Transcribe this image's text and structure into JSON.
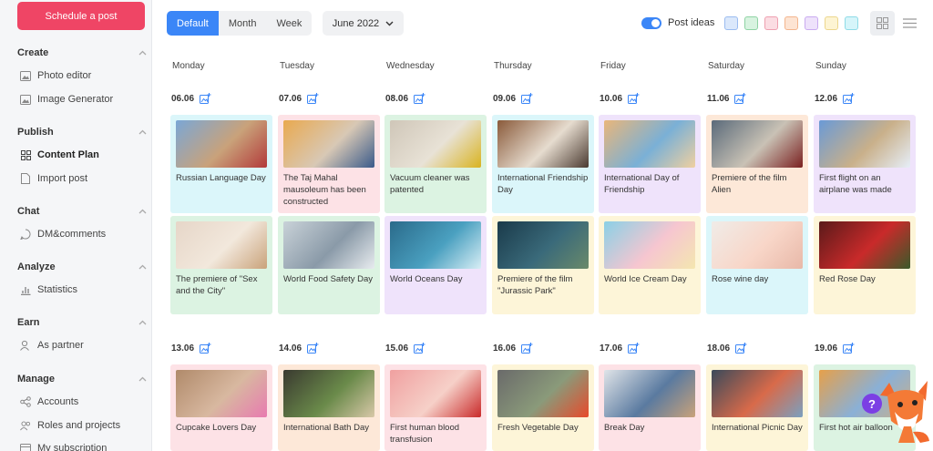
{
  "sidebar": {
    "schedule_button": "Schedule a post",
    "sections": [
      {
        "title": "Create",
        "items": [
          {
            "label": "Photo editor",
            "icon": "image-icon"
          },
          {
            "label": "Image Generator",
            "icon": "image-icon"
          }
        ]
      },
      {
        "title": "Publish",
        "items": [
          {
            "label": "Content Plan",
            "icon": "grid-icon",
            "active": true
          },
          {
            "label": "Import post",
            "icon": "document-icon"
          }
        ]
      },
      {
        "title": "Chat",
        "items": [
          {
            "label": "DM&comments",
            "icon": "chat-icon"
          }
        ]
      },
      {
        "title": "Analyze",
        "items": [
          {
            "label": "Statistics",
            "icon": "chart-icon"
          }
        ]
      },
      {
        "title": "Earn",
        "items": [
          {
            "label": "As partner",
            "icon": "user-icon"
          }
        ]
      },
      {
        "title": "Manage",
        "items": [
          {
            "label": "Accounts",
            "icon": "share-icon"
          },
          {
            "label": "Roles and projects",
            "icon": "users-icon"
          },
          {
            "label": "My subscription",
            "icon": "card-icon"
          }
        ]
      }
    ]
  },
  "toolbar": {
    "views": [
      "Default",
      "Month",
      "Week"
    ],
    "active_view": "Default",
    "month": "June 2022",
    "post_ideas_label": "Post ideas",
    "post_ideas_on": true,
    "swatches": [
      "#dbe8fb",
      "#d8f3e0",
      "#fbdde3",
      "#fde4d3",
      "#eee2fb",
      "#fdf4d3",
      "#d6f5fa"
    ]
  },
  "calendar": {
    "days": [
      "Monday",
      "Tuesday",
      "Wednesday",
      "Thursday",
      "Friday",
      "Saturday",
      "Sunday"
    ],
    "weeks": [
      {
        "dates": [
          "06.06",
          "07.06",
          "08.06",
          "09.06",
          "10.06",
          "11.06",
          "12.06"
        ],
        "rows": [
          [
            {
              "caption": "Russian Language Day",
              "bg": "#dbf6fa"
            },
            {
              "caption": "The Taj Mahal mausoleum has been constructed",
              "bg": "#fde2e6"
            },
            {
              "caption": "Vacuum cleaner was patented",
              "bg": "#dcf3e2"
            },
            {
              "caption": "International Friendship Day",
              "bg": "#dbf6fa"
            },
            {
              "caption": "International Day of Friendship",
              "bg": "#efe3fb"
            },
            {
              "caption": "Premiere of the film Alien",
              "bg": "#fde8d8"
            },
            {
              "caption": "First flight on an airplane was made",
              "bg": "#efe3fb"
            }
          ],
          [
            {
              "caption": "The premiere of \"Sex and the City\"",
              "bg": "#dcf3e2"
            },
            {
              "caption": "World Food Safety Day",
              "bg": "#dcf3e2"
            },
            {
              "caption": "World Oceans Day",
              "bg": "#efe3fb"
            },
            {
              "caption": "Premiere of the film \"Jurassic Park\"",
              "bg": "#fdf5d8"
            },
            {
              "caption": "World Ice Cream Day",
              "bg": "#fdf5d8"
            },
            {
              "caption": "Rose wine day",
              "bg": "#dbf6fa"
            },
            {
              "caption": "Red Rose Day",
              "bg": "#fdf5d8"
            }
          ]
        ]
      },
      {
        "dates": [
          "13.06",
          "14.06",
          "15.06",
          "16.06",
          "17.06",
          "18.06",
          "19.06"
        ],
        "rows": [
          [
            {
              "caption": "Cupcake Lovers Day",
              "bg": "#fde2e6"
            },
            {
              "caption": "International Bath Day",
              "bg": "#fde8d8"
            },
            {
              "caption": "First human blood transfusion",
              "bg": "#fde2e6"
            },
            {
              "caption": "Fresh Vegetable Day",
              "bg": "#fdf5d8"
            },
            {
              "caption": "Break Day",
              "bg": "#fde2e6"
            },
            {
              "caption": "International Picnic Day",
              "bg": "#fdf5d8"
            },
            {
              "caption": "First hot air balloon",
              "bg": "#dcf3e2"
            }
          ]
        ]
      }
    ]
  },
  "help_badge": "?"
}
